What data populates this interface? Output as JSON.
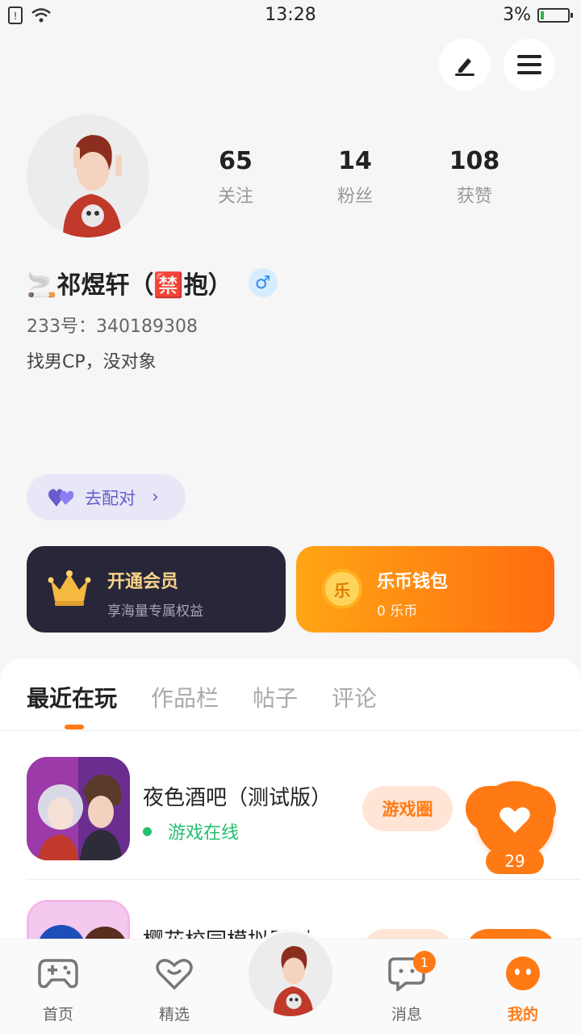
{
  "status_bar": {
    "time": "13:28",
    "battery": "3%"
  },
  "profile": {
    "stats": [
      {
        "value": "65",
        "label": "关注"
      },
      {
        "value": "14",
        "label": "粉丝"
      },
      {
        "value": "108",
        "label": "获赞"
      }
    ],
    "name": "🚬祁煜轩（🈲抱）",
    "gender_symbol": "♂",
    "uid": "233号：340189308",
    "bio": "找男CP，没对象"
  },
  "match_button": {
    "label": "去配对",
    "chevron": "›"
  },
  "vip_card": {
    "title": "开通会员",
    "subtitle": "享海量专属权益"
  },
  "wallet_card": {
    "title": "乐币钱包",
    "subtitle": "0 乐币",
    "coin_glyph": "乐"
  },
  "tabs": [
    "最近在玩",
    "作品栏",
    "帖子",
    "评论"
  ],
  "games": [
    {
      "name": "夜色酒吧（测试版）",
      "status": "游戏在线",
      "circle_label": "游戏圈"
    },
    {
      "name": "樱花校园模拟器测…"
    }
  ],
  "like_count": "29",
  "bottom_nav": [
    {
      "label": "首页",
      "icon": "gamepad-icon"
    },
    {
      "label": "精选",
      "icon": "heart-outline-icon"
    },
    {
      "label": "消息",
      "icon": "chat-icon",
      "badge": "1"
    },
    {
      "label": "我的",
      "icon": "face-icon"
    }
  ],
  "colors": {
    "accent": "#ff7a14",
    "online": "#23c06d",
    "vip_bg": "#28273a",
    "match": "#6a5acd"
  }
}
